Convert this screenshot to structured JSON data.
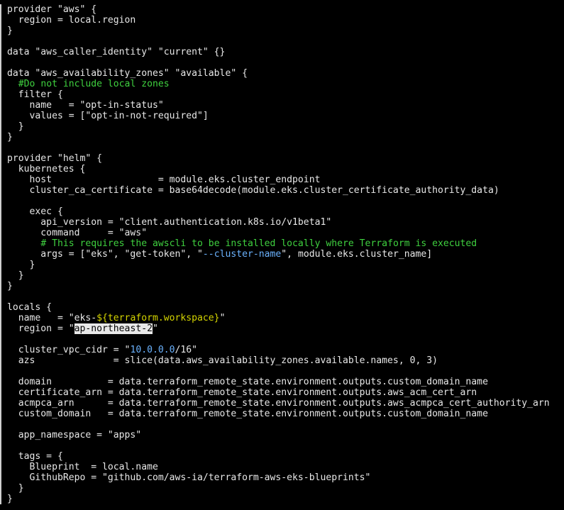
{
  "editor": {
    "colors": {
      "background": "#000000",
      "text": "#e8e8e8",
      "comment": "#3fd13f",
      "interpolation": "#d4d400",
      "number": "#6bb3ff",
      "selection_bg": "#e8e8e8"
    },
    "lines": [
      [
        {
          "t": "provider \"aws\" {"
        }
      ],
      [
        {
          "t": "  region = local.region"
        }
      ],
      [
        {
          "t": "}"
        }
      ],
      [
        {
          "t": ""
        }
      ],
      [
        {
          "t": "data \"aws_caller_identity\" \"current\" {}"
        }
      ],
      [
        {
          "t": ""
        }
      ],
      [
        {
          "t": "data \"aws_availability_zones\" \"available\" {"
        }
      ],
      [
        {
          "t": "  "
        },
        {
          "t": "#Do not include local zones",
          "c": "comment"
        }
      ],
      [
        {
          "t": "  filter {"
        }
      ],
      [
        {
          "t": "    name   = \"opt-in-status\""
        }
      ],
      [
        {
          "t": "    values = [\"opt-in-not-required\"]"
        }
      ],
      [
        {
          "t": "  }"
        }
      ],
      [
        {
          "t": "}"
        }
      ],
      [
        {
          "t": ""
        }
      ],
      [
        {
          "t": "provider \"helm\" {"
        }
      ],
      [
        {
          "t": "  kubernetes {"
        }
      ],
      [
        {
          "t": "    host                   = module.eks.cluster_endpoint"
        }
      ],
      [
        {
          "t": "    cluster_ca_certificate = base64decode(module.eks.cluster_certificate_authority_data)"
        }
      ],
      [
        {
          "t": ""
        }
      ],
      [
        {
          "t": "    exec {"
        }
      ],
      [
        {
          "t": "      api_version = \"client.authentication.k8s.io/v1beta1\""
        }
      ],
      [
        {
          "t": "      command     = \"aws\""
        }
      ],
      [
        {
          "t": "      "
        },
        {
          "t": "# This requires the awscli to be installed locally where Terraform is executed",
          "c": "comment"
        }
      ],
      [
        {
          "t": "      args = [\"eks\", \"get-token\", \""
        },
        {
          "t": "--cluster-name",
          "c": "flag"
        },
        {
          "t": "\", module.eks.cluster_name]"
        }
      ],
      [
        {
          "t": "    }"
        }
      ],
      [
        {
          "t": "  }"
        }
      ],
      [
        {
          "t": "}"
        }
      ],
      [
        {
          "t": ""
        }
      ],
      [
        {
          "t": "locals {"
        }
      ],
      [
        {
          "t": "  name   = \"eks-"
        },
        {
          "t": "${terraform.workspace}",
          "c": "interp"
        },
        {
          "t": "\""
        }
      ],
      [
        {
          "t": "  region = \""
        },
        {
          "t": "ap-northeast-2",
          "c": "selected"
        },
        {
          "t": "\""
        }
      ],
      [
        {
          "t": ""
        }
      ],
      [
        {
          "t": "  cluster_vpc_cidr = \""
        },
        {
          "t": "10.0.0.0",
          "c": "number"
        },
        {
          "t": "/16\""
        }
      ],
      [
        {
          "t": "  azs              = slice(data.aws_availability_zones.available.names, 0, 3)"
        }
      ],
      [
        {
          "t": ""
        }
      ],
      [
        {
          "t": "  domain          = data.terraform_remote_state.environment.outputs.custom_domain_name"
        }
      ],
      [
        {
          "t": "  certificate_arn = data.terraform_remote_state.environment.outputs.aws_acm_cert_arn"
        }
      ],
      [
        {
          "t": "  acmpca_arn      = data.terraform_remote_state.environment.outputs.aws_acmpca_cert_authority_arn"
        }
      ],
      [
        {
          "t": "  custom_domain   = data.terraform_remote_state.environment.outputs.custom_domain_name"
        }
      ],
      [
        {
          "t": ""
        }
      ],
      [
        {
          "t": "  app_namespace = \"apps\""
        }
      ],
      [
        {
          "t": ""
        }
      ],
      [
        {
          "t": "  tags = {"
        }
      ],
      [
        {
          "t": "    Blueprint  = local.name"
        }
      ],
      [
        {
          "t": "    GithubRepo = \"github.com/aws-ia/terraform-aws-eks-blueprints\""
        }
      ],
      [
        {
          "t": "  }"
        }
      ],
      [
        {
          "t": "}"
        }
      ]
    ]
  }
}
